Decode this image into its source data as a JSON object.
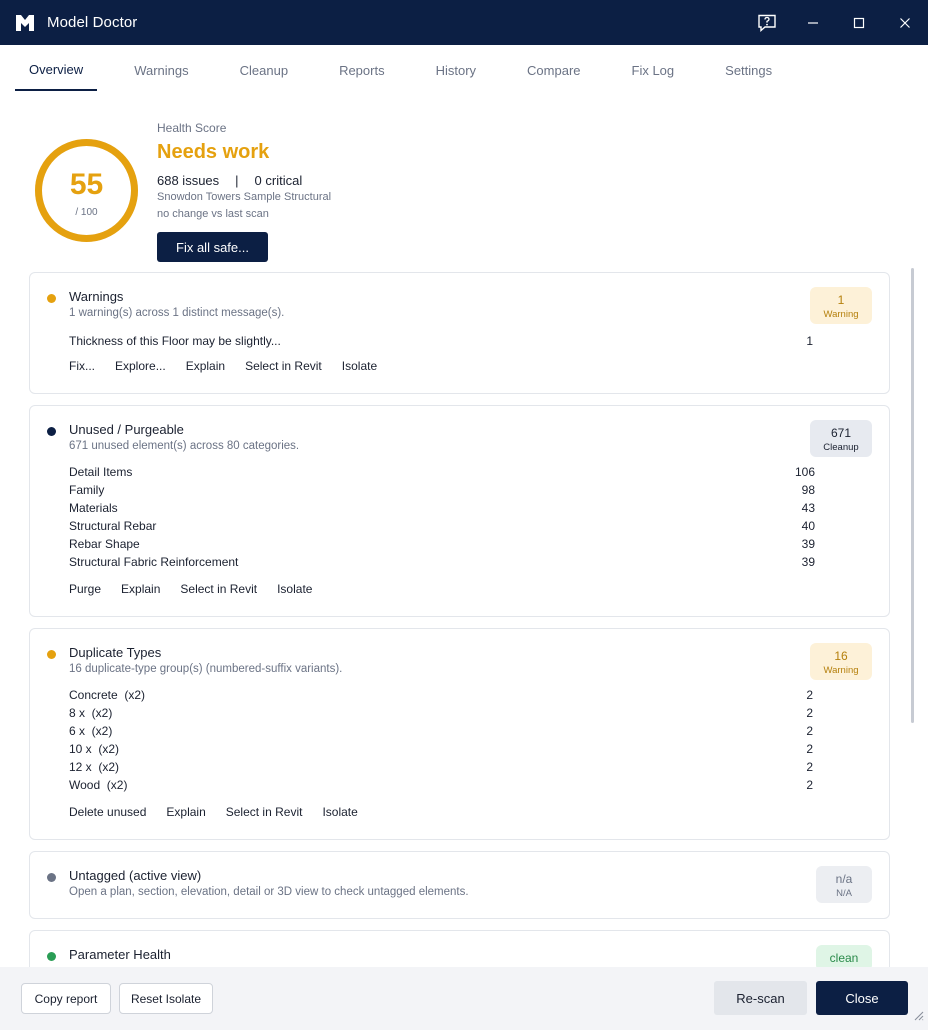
{
  "window": {
    "title": "Model Doctor"
  },
  "tabs": [
    "Overview",
    "Warnings",
    "Cleanup",
    "Reports",
    "History",
    "Compare",
    "Fix Log",
    "Settings"
  ],
  "health": {
    "label": "Health Score",
    "score": "55",
    "max": "/ 100",
    "score_fraction": 0.55,
    "status": "Needs work",
    "issues": "688 issues",
    "separator": "|",
    "critical": "0 critical",
    "model": "Snowdon Towers Sample Structural",
    "change": "no change vs last scan",
    "fix_button": "Fix all safe..."
  },
  "cards": {
    "warnings": {
      "title": "Warnings",
      "subtitle": "1 warning(s) across 1 distinct message(s).",
      "badge_count": "1",
      "badge_label": "Warning",
      "rows": [
        {
          "label": "Thickness of this Floor may be slightly...",
          "value": "1"
        }
      ],
      "actions": [
        "Fix...",
        "Explore...",
        "Explain",
        "Select in Revit",
        "Isolate"
      ]
    },
    "unused": {
      "title": "Unused / Purgeable",
      "subtitle": "671 unused element(s) across 80 categories.",
      "badge_count": "671",
      "badge_label": "Cleanup",
      "rows": [
        {
          "label": "Detail Items",
          "value": "106"
        },
        {
          "label": "Family",
          "value": "98"
        },
        {
          "label": "Materials",
          "value": "43"
        },
        {
          "label": "Structural Rebar",
          "value": "40"
        },
        {
          "label": "Rebar Shape",
          "value": "39"
        },
        {
          "label": "Structural Fabric Reinforcement",
          "value": "39"
        }
      ],
      "actions": [
        "Purge",
        "Explain",
        "Select in Revit",
        "Isolate"
      ]
    },
    "duplicates": {
      "title": "Duplicate Types",
      "subtitle": "16 duplicate-type group(s) (numbered-suffix variants).",
      "badge_count": "16",
      "badge_label": "Warning",
      "rows": [
        {
          "label": "Concrete  (x2)",
          "value": "2"
        },
        {
          "label": "8 x  (x2)",
          "value": "2"
        },
        {
          "label": "6 x  (x2)",
          "value": "2"
        },
        {
          "label": "10 x  (x2)",
          "value": "2"
        },
        {
          "label": "12 x  (x2)",
          "value": "2"
        },
        {
          "label": "Wood  (x2)",
          "value": "2"
        }
      ],
      "actions": [
        "Delete unused",
        "Explain",
        "Select in Revit",
        "Isolate"
      ]
    },
    "untagged": {
      "title": "Untagged (active view)",
      "subtitle": "Open a plan, section, elevation, detail or 3D view to check untagged elements.",
      "badge_count": "n/a",
      "badge_label": "N/A"
    },
    "parameters": {
      "title": "Parameter Health",
      "badge_count": "clean"
    }
  },
  "footer": {
    "copy_report": "Copy report",
    "reset_isolate": "Reset Isolate",
    "rescan": "Re-scan",
    "close": "Close"
  },
  "colors": {
    "navy": "#0c1f44",
    "warning": "#e5a10f",
    "ok": "#2a9d55",
    "neutral": "#6b7385"
  }
}
